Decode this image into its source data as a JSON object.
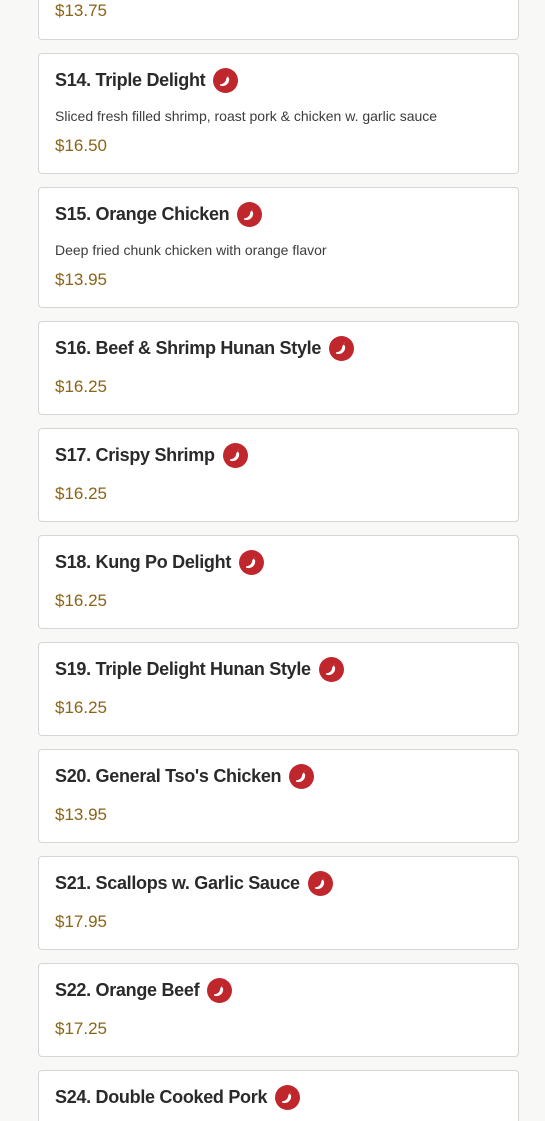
{
  "colors": {
    "background": "#f8f8f7",
    "card": "#ffffff",
    "border": "#d6d6d6",
    "name": "#2a2a2a",
    "price": "#8a6418",
    "spicy_icon": "#c0272d"
  },
  "icons": {
    "spicy": "chili-pepper-icon"
  },
  "items": [
    {
      "name": "",
      "description": "",
      "price": "$13.75",
      "spicy": false
    },
    {
      "name": "S14. Triple Delight",
      "description": "Sliced fresh filled shrimp, roast pork & chicken w. garlic sauce",
      "price": "$16.50",
      "spicy": true
    },
    {
      "name": "S15. Orange Chicken",
      "description": "Deep fried chunk chicken with orange flavor",
      "price": "$13.95",
      "spicy": true
    },
    {
      "name": "S16. Beef & Shrimp Hunan Style",
      "description": "",
      "price": "$16.25",
      "spicy": true
    },
    {
      "name": "S17. Crispy Shrimp",
      "description": "",
      "price": "$16.25",
      "spicy": true
    },
    {
      "name": "S18. Kung Po Delight",
      "description": "",
      "price": "$16.25",
      "spicy": true
    },
    {
      "name": "S19. Triple Delight Hunan Style",
      "description": "",
      "price": "$16.25",
      "spicy": true
    },
    {
      "name": "S20. General Tso's Chicken",
      "description": "",
      "price": "$13.95",
      "spicy": true
    },
    {
      "name": "S21. Scallops w. Garlic Sauce",
      "description": "",
      "price": "$17.95",
      "spicy": true
    },
    {
      "name": "S22. Orange Beef",
      "description": "",
      "price": "$17.25",
      "spicy": true
    },
    {
      "name": "S24. Double Cooked Pork",
      "description": "",
      "price": "",
      "spicy": true
    }
  ]
}
